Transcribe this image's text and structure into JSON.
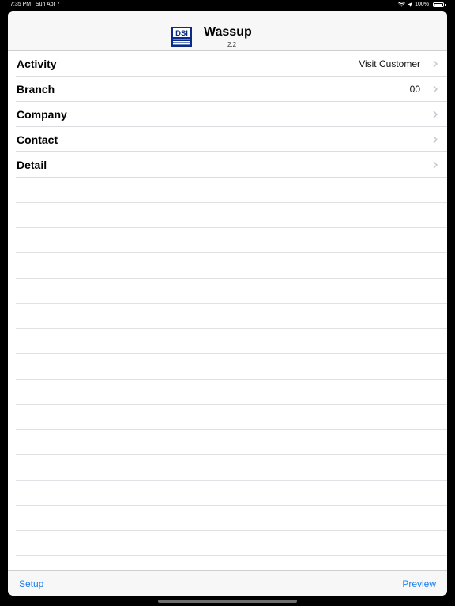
{
  "status": {
    "time": "7:35 PM",
    "date": "Sun Apr 7",
    "battery_label": "100%",
    "icons": [
      "wifi-icon",
      "location-icon",
      "battery-icon"
    ]
  },
  "header": {
    "logo_text": "DSI",
    "title": "Wassup",
    "version": "2.2"
  },
  "rows": [
    {
      "label": "Activity",
      "value": "Visit Customer"
    },
    {
      "label": "Branch",
      "value": "00"
    },
    {
      "label": "Company",
      "value": ""
    },
    {
      "label": "Contact",
      "value": ""
    },
    {
      "label": "Detail",
      "value": ""
    }
  ],
  "toolbar": {
    "left_label": "Setup",
    "right_label": "Preview"
  },
  "colors": {
    "accent": "#1a7ef0",
    "logo_blue": "#0a2a8a"
  }
}
